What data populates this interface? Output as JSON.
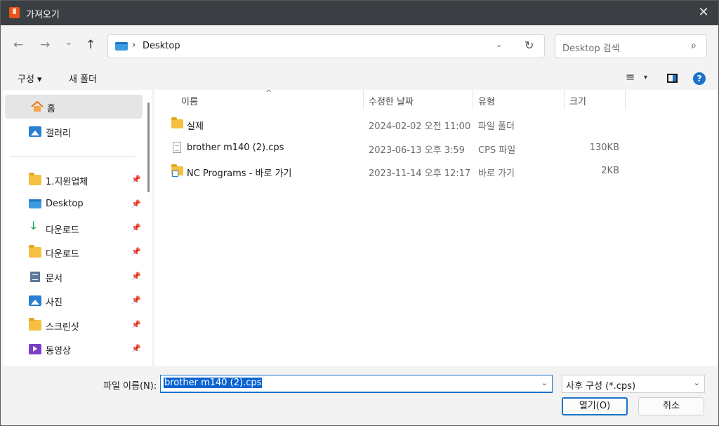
{
  "window": {
    "title": "가져오기",
    "close_glyph": "✕"
  },
  "nav": {
    "back_glyph": "←",
    "forward_glyph": "→",
    "recent_glyph": "⌄",
    "up_glyph": "↑",
    "address": {
      "separator": "›",
      "path": "Desktop",
      "dropdown_glyph": "⌄",
      "refresh_glyph": "↻"
    },
    "search": {
      "placeholder": "Desktop 검색",
      "icon_glyph": "⌕"
    }
  },
  "toolbar": {
    "organize_label": "구성 ▾",
    "new_folder_label": "새 폴더",
    "view_glyph": "≡",
    "view_drop_glyph": "▾",
    "help_glyph": "?"
  },
  "sidebar": {
    "home": {
      "label": "홈",
      "icon": "home-icon"
    },
    "gallery": {
      "label": "갤러리",
      "icon": "gallery-icon"
    },
    "pinned": [
      {
        "label": "1.지원업체",
        "icon": "folder-icon"
      },
      {
        "label": "Desktop",
        "icon": "desktop-icon"
      },
      {
        "label": "다운로드",
        "icon": "download-icon",
        "glyph": "↓"
      },
      {
        "label": "다운로드",
        "icon": "folder-icon"
      },
      {
        "label": "문서",
        "icon": "document-icon"
      },
      {
        "label": "사진",
        "icon": "pictures-icon"
      },
      {
        "label": "스크린샷",
        "icon": "folder-icon"
      },
      {
        "label": "동영상",
        "icon": "videos-icon"
      }
    ],
    "pin_glyph": "📌"
  },
  "file_list": {
    "columns": {
      "name": "이름",
      "date": "수정한 날짜",
      "type": "유형",
      "size": "크기"
    },
    "sort_glyph": "^",
    "rows": [
      {
        "name": "실제",
        "date": "2024-02-02 오전 11:00",
        "type": "파일 폴더",
        "size": "",
        "icon": "folder-icon"
      },
      {
        "name": "brother m140 (2).cps",
        "date": "2023-06-13 오후 3:59",
        "type": "CPS 파일",
        "size": "130KB",
        "icon": "file-icon"
      },
      {
        "name": "NC Programs - 바로 가기",
        "date": "2023-11-14 오후 12:17",
        "type": "바로 가기",
        "size": "2KB",
        "icon": "shortcut-folder-icon"
      }
    ]
  },
  "footer": {
    "filename_label": "파일 이름(N):",
    "filename_value": "brother m140 (2).cps",
    "filter_value": "사후 구성 (*.cps)",
    "dropdown_glyph": "⌄",
    "open_label": "열기(O)",
    "cancel_label": "취소"
  },
  "colors": {
    "accent": "#1a73c9",
    "titlebar": "#3b3f44",
    "folder": "#f5c042"
  }
}
